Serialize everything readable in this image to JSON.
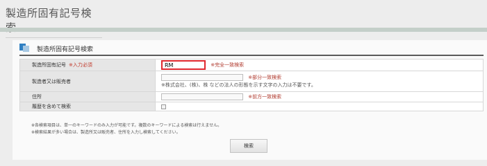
{
  "page": {
    "title": "製造所固有記号検索"
  },
  "section": {
    "title": "製造所固有記号検索"
  },
  "form": {
    "rows": {
      "code": {
        "label": "製造所固有記号",
        "required": "※入力必須",
        "value": "RM",
        "hint": "※完全一致検索"
      },
      "maker": {
        "label": "製造者又は販売者",
        "value": "",
        "hint": "※部分一致検索",
        "note": "※株式会社、(株)、株 などの法人の形態を示す文字の入力は不要です。"
      },
      "address": {
        "label": "住所",
        "value": "",
        "hint": "※前方一致検索"
      },
      "history": {
        "label": "履歴を含めて検索",
        "checked": false
      }
    }
  },
  "notes": [
    "※各検索項目は、単一のキーワードのみ入力が可能です。複数のキーワードによる検索は行えません。",
    "※検索結果が多い場合は、製造所又は販売者、住所を入力し検索してください。"
  ],
  "search_button": {
    "label": "検索"
  }
}
